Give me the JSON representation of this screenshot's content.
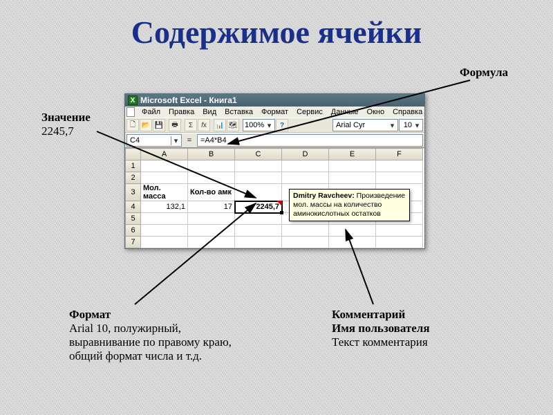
{
  "slide": {
    "title": "Содержимое ячейки"
  },
  "callouts": {
    "formula": {
      "heading": "Формула"
    },
    "value": {
      "heading": "Значение",
      "text": "2245,7"
    },
    "format": {
      "heading": "Формат",
      "line1": "Arial 10, полужирный,",
      "line2": " выравнивание по правому краю,",
      "line3": "общий формат числа и т.д."
    },
    "comment": {
      "heading": "Комментарий",
      "line1": "Имя пользователя",
      "line2": "Текст комментария"
    }
  },
  "excel": {
    "titlebar": "Microsoft Excel - Книга1",
    "menu": {
      "file": "Файл",
      "edit": "Правка",
      "view": "Вид",
      "insert": "Вставка",
      "format": "Формат",
      "tools": "Сервис",
      "data": "Данные",
      "window": "Окно",
      "help": "Справка"
    },
    "toolbar": {
      "zoom": "100%",
      "font_name": "Arial Cyr",
      "font_size": "10"
    },
    "formulabar": {
      "namebox": "C4",
      "formula": "=A4*B4"
    },
    "columns": [
      "A",
      "B",
      "C",
      "D",
      "E",
      "F"
    ],
    "rows": [
      "1",
      "2",
      "3",
      "4",
      "5",
      "6",
      "7"
    ],
    "labels": {
      "a3": "Мол. масса",
      "b3": "Кол-во амк"
    },
    "values": {
      "a4": "132,1",
      "b4": "17",
      "c4": "2245,7"
    },
    "comment": {
      "author": "Dmitry Ravcheev:",
      "body": "Произведение мол. массы на количество аминокислотных остатков"
    }
  }
}
